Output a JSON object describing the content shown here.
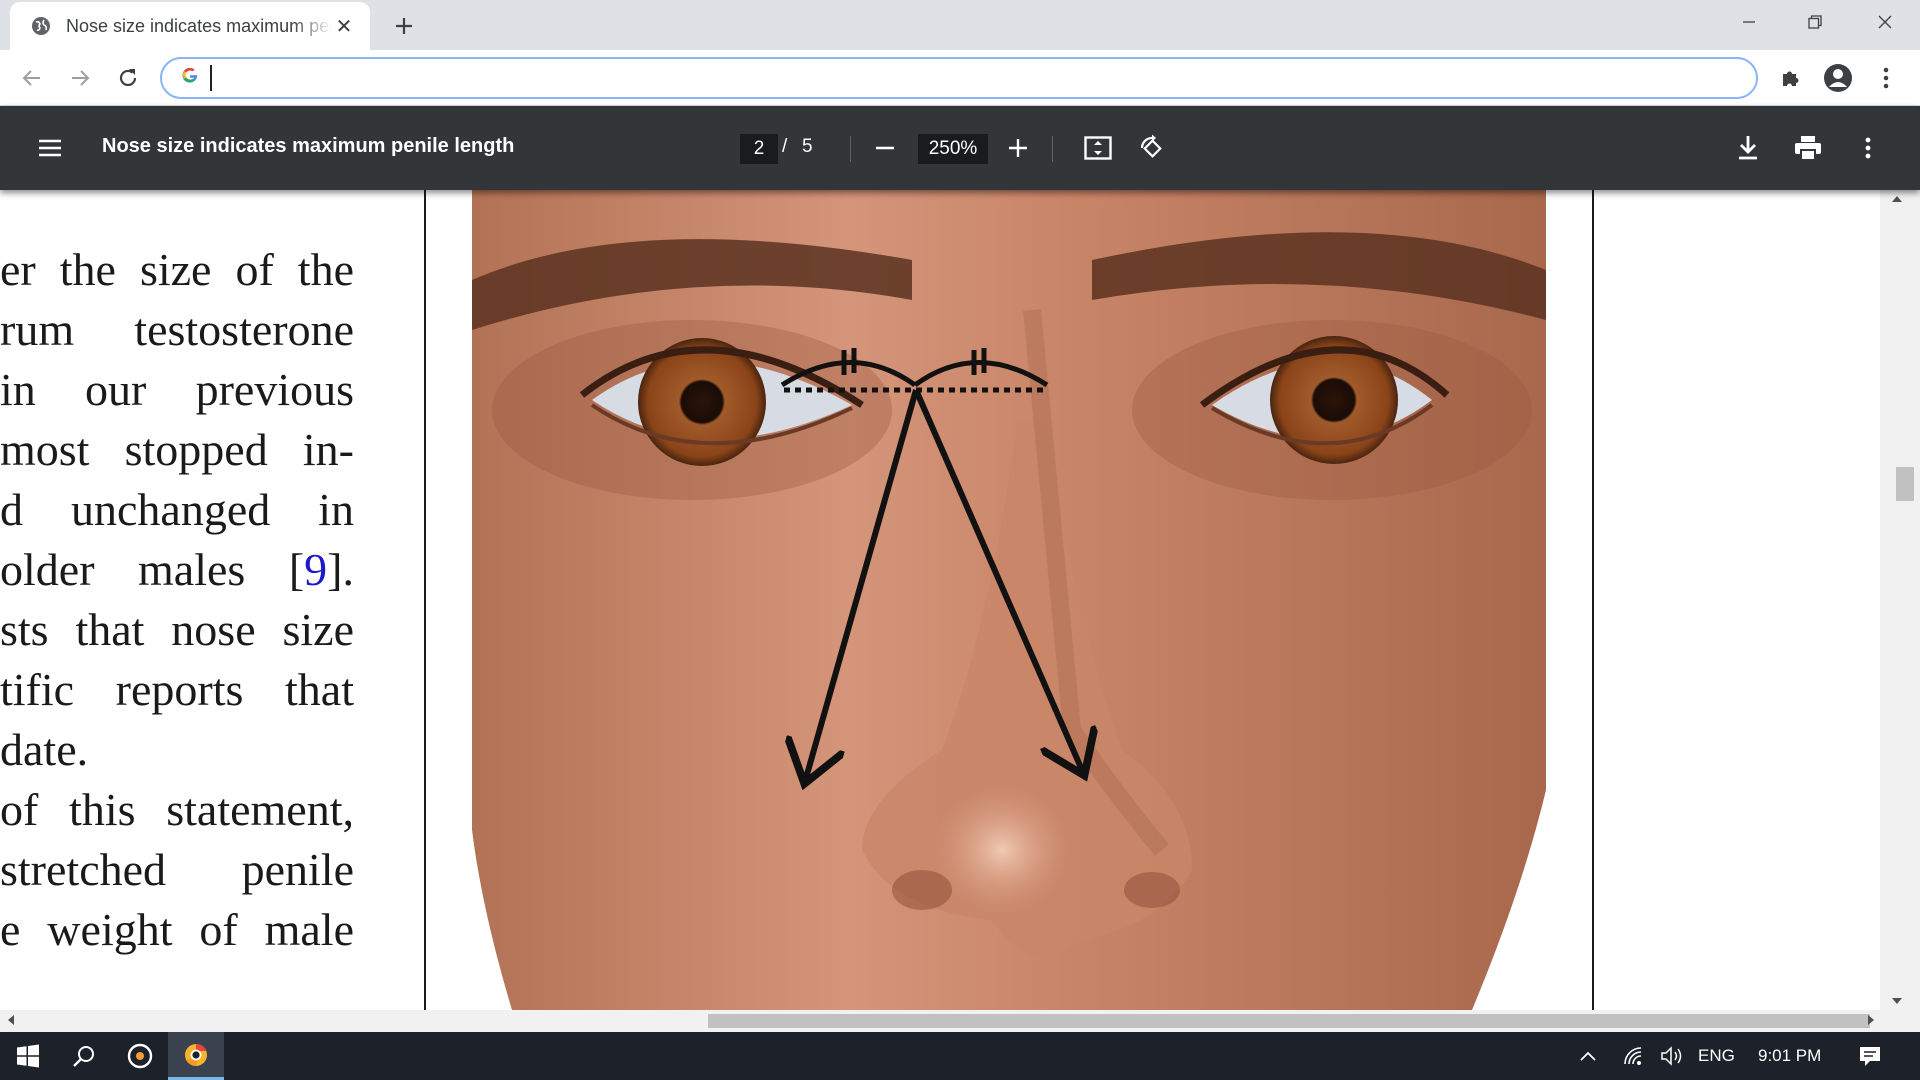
{
  "browser": {
    "tab_title": "Nose size indicates maximum penile length",
    "tab_close": "✕",
    "new_tab": "+",
    "address_value": "",
    "colors": {
      "tabstrip": "#dee1e6",
      "omnibox_focus": "#8ab4f8"
    }
  },
  "pdf_toolbar": {
    "title": "Nose size indicates maximum penile length",
    "current_page": "2",
    "page_separator": "/",
    "total_pages": "5",
    "zoom": "250%",
    "background": "#323639"
  },
  "document": {
    "lines": [
      {
        "text": "er the size of the"
      },
      {
        "text": "rum testosterone"
      },
      {
        "text": " in our previous"
      },
      {
        "text": "most stopped in-"
      },
      {
        "text": "d unchanged in"
      },
      {
        "text_before": " older males [",
        "cite": "9",
        "text_after": "]."
      },
      {
        "text": "sts that nose size"
      },
      {
        "text": "tific reports that"
      },
      {
        "text": " date.",
        "end": true
      },
      {
        "text": "of this statement,"
      },
      {
        "text": " stretched penile"
      },
      {
        "text": "e weight of male"
      }
    ],
    "citation_color": "#1a1acc",
    "figure_icon": "face-nose-measurement-illustration"
  },
  "taskbar": {
    "language": "ENG",
    "time": "9:01 PM"
  }
}
